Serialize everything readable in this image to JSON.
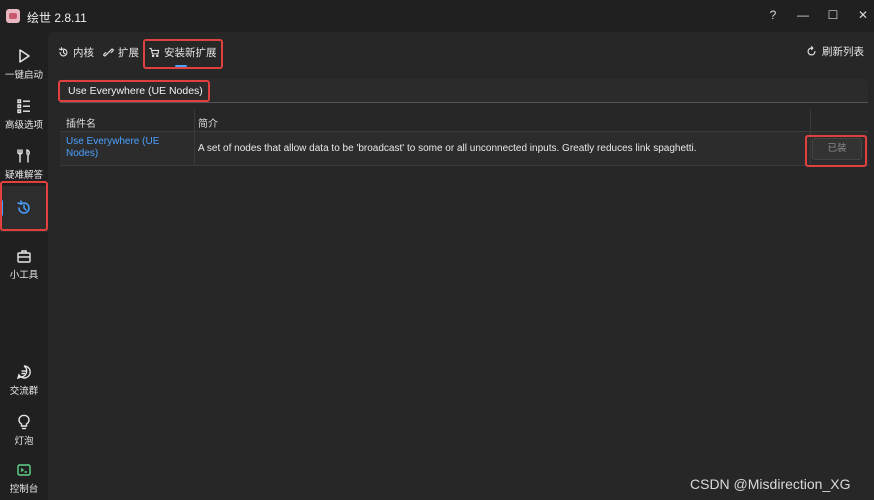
{
  "window": {
    "title": "绘世 2.8.11",
    "help_glyph": "?",
    "min_glyph": "—",
    "max_glyph": "☐",
    "close_glyph": "✕"
  },
  "sidebar": {
    "items": [
      {
        "label": "一键启动",
        "icon": "play-icon"
      },
      {
        "label": "高级选项",
        "icon": "list-icon"
      },
      {
        "label": "疑难解答",
        "icon": "wrench-icon"
      },
      {
        "label": "",
        "icon": "history-icon",
        "active": true
      },
      {
        "label": "小工具",
        "icon": "toolbox-icon"
      },
      {
        "label": "交流群",
        "icon": "chat-icon"
      },
      {
        "label": "灯泡",
        "icon": "lightbulb-icon"
      },
      {
        "label": "控制台",
        "icon": "console-icon"
      }
    ]
  },
  "toolbar": {
    "tabs": [
      {
        "label": "内核",
        "icon": "history-icon"
      },
      {
        "label": "扩展",
        "icon": "puzzle-icon"
      },
      {
        "label": "安装新扩展",
        "icon": "cart-icon",
        "active": true
      }
    ],
    "refresh_label": "刷新列表"
  },
  "search": {
    "value": "Use Everywhere (UE Nodes)"
  },
  "table": {
    "headers": [
      "插件名",
      "简介"
    ],
    "rows": [
      {
        "name": "Use Everywhere (UE Nodes)",
        "description": "A set of nodes that allow data to be 'broadcast' to some or all unconnected inputs. Greatly reduces link spaghetti.",
        "action": "已装"
      }
    ]
  },
  "watermark": "CSDN @Misdirection_XG",
  "colors": {
    "accent": "#4aa0ff",
    "highlight": "#e0413e",
    "background": "#202020",
    "panel": "#272727"
  }
}
